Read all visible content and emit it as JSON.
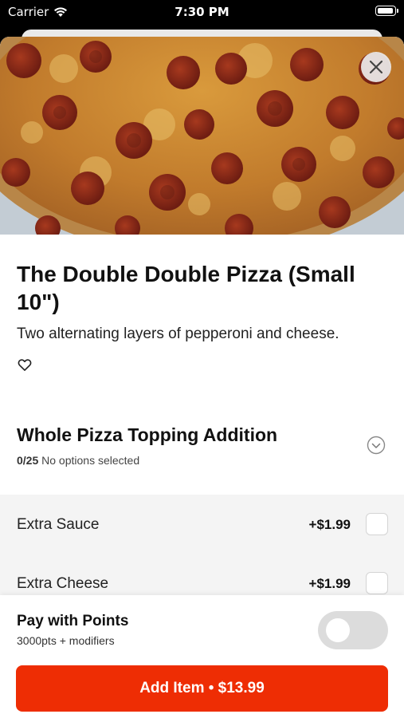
{
  "status_bar": {
    "carrier": "Carrier",
    "time": "7:30 PM"
  },
  "hero": {
    "image": "pizza-photo",
    "close_icon": "close-icon"
  },
  "item": {
    "title": "The Double Double Pizza (Small 10\")",
    "description": "Two alternating layers of pepperoni and cheese.",
    "favorite_icon": "heart-icon"
  },
  "modifier_group": {
    "title": "Whole Pizza Topping Addition",
    "count": "0/25",
    "status": "No options selected",
    "expand_icon": "chevron-down-icon",
    "options": [
      {
        "name": "Extra Sauce",
        "price": "+$1.99",
        "checked": false
      },
      {
        "name": "Extra Cheese",
        "price": "+$1.99",
        "checked": false
      }
    ]
  },
  "points": {
    "title": "Pay with Points",
    "subtitle": "3000pts + modifiers",
    "enabled": false
  },
  "add_button": {
    "label": "Add Item • $13.99"
  },
  "colors": {
    "accent": "#ee2d04",
    "toggle_off": "#dcdcdc",
    "options_bg": "#f4f4f4"
  }
}
